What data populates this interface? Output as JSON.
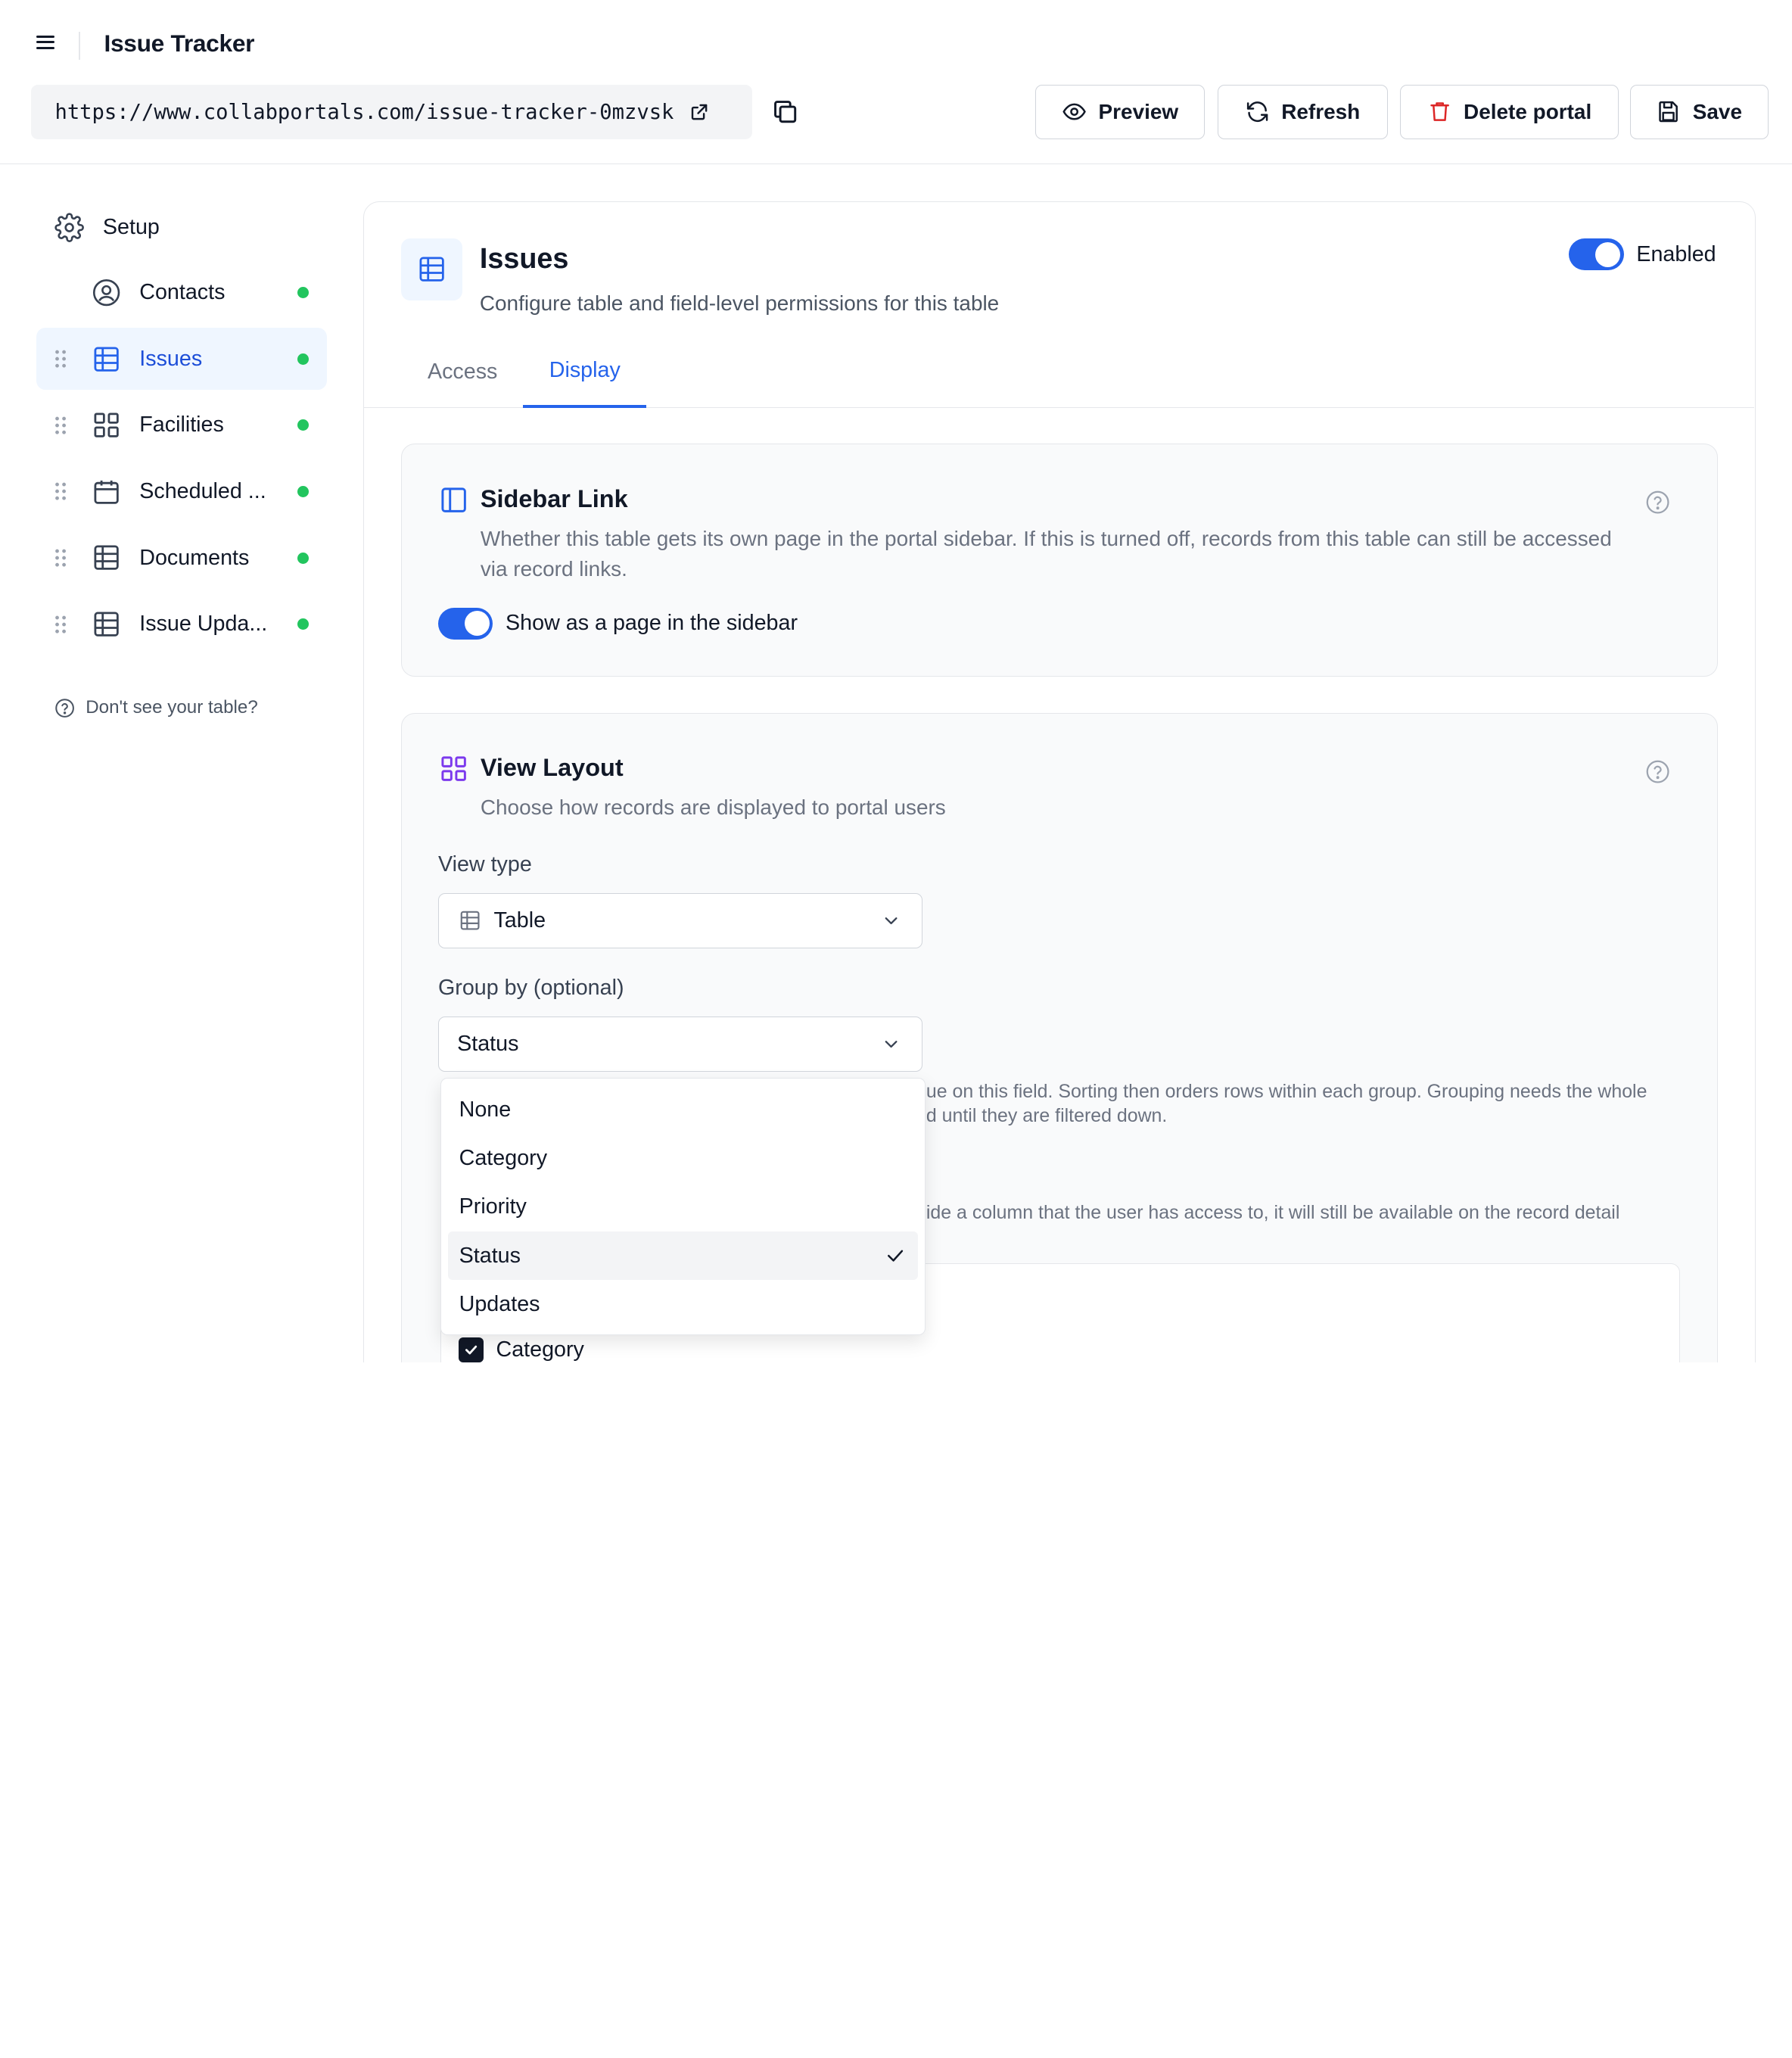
{
  "header": {
    "app_title": "Issue Tracker",
    "url": "https://www.collabportals.com/issue-tracker-0mzvsk",
    "buttons": {
      "preview": "Preview",
      "refresh": "Refresh",
      "delete": "Delete portal",
      "save": "Save"
    }
  },
  "sidebar": {
    "setup_label": "Setup",
    "items": [
      {
        "label": "Contacts",
        "icon": "user-circle-icon",
        "status": "green"
      },
      {
        "label": "Issues",
        "icon": "table-icon",
        "status": "green",
        "active": true
      },
      {
        "label": "Facilities",
        "icon": "grid-icon",
        "status": "green"
      },
      {
        "label": "Scheduled ...",
        "icon": "calendar-icon",
        "status": "green"
      },
      {
        "label": "Documents",
        "icon": "table-icon",
        "status": "green"
      },
      {
        "label": "Issue Upda...",
        "icon": "table-icon",
        "status": "green"
      }
    ],
    "help_link": "Don't see your table?"
  },
  "main": {
    "title": "Issues",
    "subtitle": "Configure table and field-level permissions for this table",
    "enabled_label": "Enabled",
    "tabs": [
      {
        "label": "Access",
        "active": false
      },
      {
        "label": "Display",
        "active": true
      }
    ],
    "sidebar_link": {
      "title": "Sidebar Link",
      "description": "Whether this table gets its own page in the portal sidebar. If this is turned off, records from this table can still be accessed via record links.",
      "toggle_label": "Show as a page in the sidebar"
    },
    "view_layout": {
      "title": "View Layout",
      "description": "Choose how records are displayed to portal users",
      "view_type_label": "View type",
      "view_type_value": "Table",
      "group_by_label": "Group by (optional)",
      "group_by_value": "Status",
      "group_help_line1": "ue on this field. Sorting then orders rows within each group. Grouping needs the whole",
      "group_help_line2": "d until they are filtered down.",
      "columns_help": "ide a column that the user has access to, it will still be available on the record detail",
      "first_column": "Category"
    },
    "dropdown_options": [
      "None",
      "Category",
      "Priority",
      "Status",
      "Updates"
    ],
    "dropdown_selected": "Status"
  },
  "colors": {
    "accent": "#2563eb",
    "status_green": "#22c55e",
    "danger": "#dc2626",
    "purple": "#7c3aed"
  }
}
